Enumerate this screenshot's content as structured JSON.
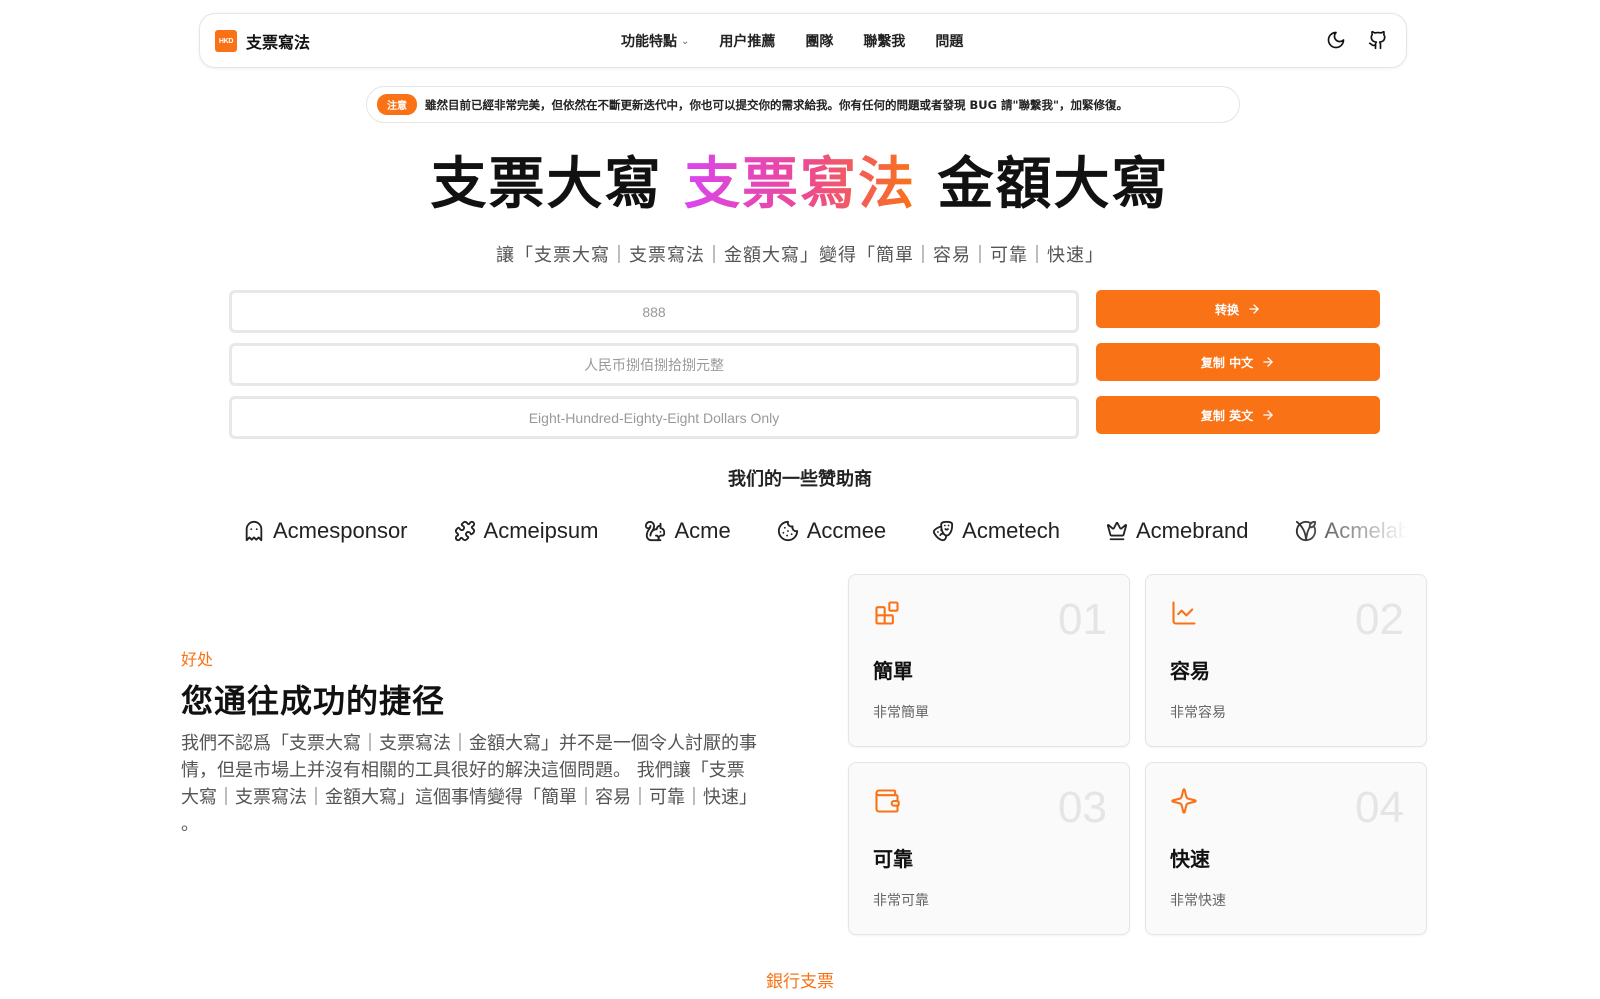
{
  "brand": {
    "logo_text": "HKD",
    "name": "支票寫法"
  },
  "nav": {
    "links": [
      {
        "label": "功能特點",
        "has_dropdown": true
      },
      {
        "label": "用户推薦"
      },
      {
        "label": "團隊"
      },
      {
        "label": "聯繫我"
      },
      {
        "label": "問題"
      }
    ],
    "icons": [
      "moon-icon",
      "github-icon"
    ]
  },
  "notice": {
    "badge": "注意",
    "text": "雖然目前已經非常完美，但依然在不斷更新迭代中，你也可以提交你的需求給我。你有任何的問題或者發現 BUG 請\"聯繫我\"，加緊修復。"
  },
  "hero": {
    "title_part1": "支票大寫",
    "title_part2": "支票寫法",
    "title_part3": "金額大寫",
    "subtitle": "讓「支票大寫｜支票寫法｜金額大寫」變得「簡單｜容易｜可靠｜快速」"
  },
  "converter": {
    "amount_placeholder": "888",
    "chinese_placeholder": "人民币捌佰捌拾捌元整",
    "english_placeholder": "Eight-Hundred-Eighty-Eight Dollars Only",
    "convert_label": "转换",
    "copy_chinese_label": "复制 中文",
    "copy_english_label": "复制 英文"
  },
  "sponsors": {
    "title": "我们的一些赞助商",
    "items": [
      {
        "name": "Acmesponsor",
        "icon": "ghost-icon"
      },
      {
        "name": "Acmeipsum",
        "icon": "puzzle-icon"
      },
      {
        "name": "Acme",
        "icon": "squirrel-icon"
      },
      {
        "name": "Accmee",
        "icon": "cookie-icon"
      },
      {
        "name": "Acmetech",
        "icon": "drama-icon"
      },
      {
        "name": "Acmebrand",
        "icon": "crown-icon"
      },
      {
        "name": "Acmelabs",
        "icon": "vegan-icon"
      }
    ]
  },
  "benefits": {
    "eyebrow": "好处",
    "title": "您通往成功的捷径",
    "description": "我們不認爲「支票大寫｜支票寫法｜金額大寫」并不是一個令人討厭的事情，但是市場上并沒有相關的工具很好的解決這個問題。 我們讓「支票大寫｜支票寫法｜金額大寫」這個事情變得「簡單｜容易｜可靠｜快速」 。",
    "cards": [
      {
        "number": "01",
        "title": "簡單",
        "desc": "非常簡單",
        "icon": "blocks-icon"
      },
      {
        "number": "02",
        "title": "容易",
        "desc": "非常容易",
        "icon": "line-chart-icon"
      },
      {
        "number": "03",
        "title": "可靠",
        "desc": "非常可靠",
        "icon": "wallet-icon"
      },
      {
        "number": "04",
        "title": "快速",
        "desc": "非常快速",
        "icon": "sparkle-icon"
      }
    ]
  },
  "next_section": {
    "label": "銀行支票"
  },
  "colors": {
    "accent": "#f97316",
    "gradient_start": "#d946ef",
    "gradient_end": "#f97316"
  }
}
